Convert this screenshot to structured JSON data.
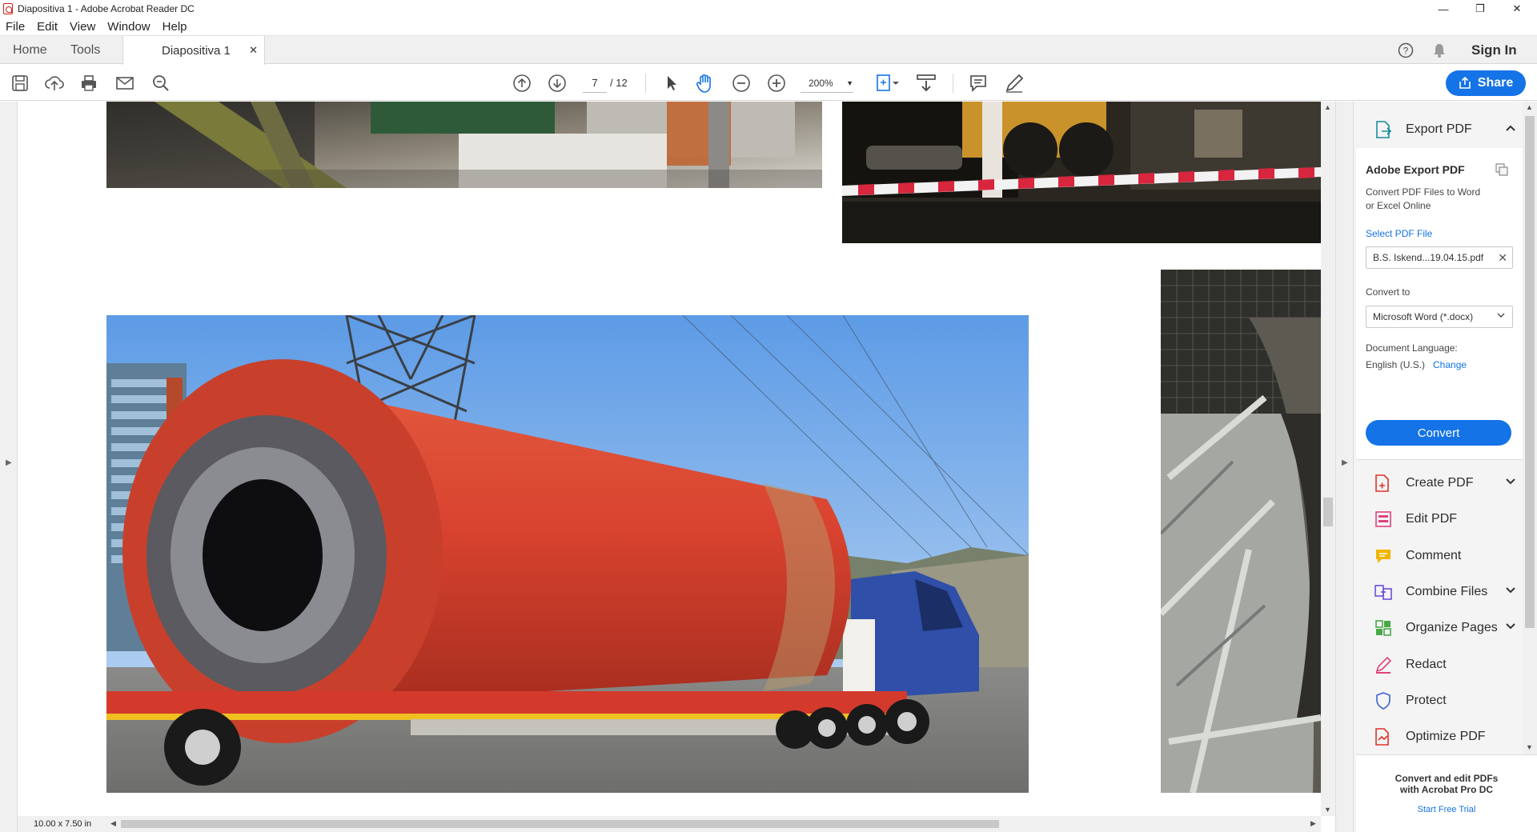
{
  "window": {
    "title": "Diapositiva 1 - Adobe Acrobat Reader DC"
  },
  "menu": {
    "file": "File",
    "edit": "Edit",
    "view": "View",
    "window": "Window",
    "help": "Help"
  },
  "tabs": {
    "home": "Home",
    "tools": "Tools",
    "document": "Diapositiva 1"
  },
  "header": {
    "sign_in": "Sign In"
  },
  "toolbar": {
    "current_page": "7",
    "page_total": "/ 12",
    "zoom": "200%",
    "share": "Share"
  },
  "statusbar": {
    "page_size": "10.00 x 7.50 in"
  },
  "export_panel": {
    "header": "Export PDF",
    "title": "Adobe Export PDF",
    "description_line1": "Convert PDF Files to Word",
    "description_line2": "or Excel Online",
    "select_label": "Select PDF File",
    "selected_file": "B.S. Iskend...19.04.15.pdf",
    "convert_to_label": "Convert to",
    "format": "Microsoft Word (*.docx)",
    "language_label": "Document Language:",
    "language_value": "English (U.S.)",
    "change_link": "Change",
    "convert_button": "Convert"
  },
  "tools": [
    {
      "label": "Create PDF",
      "icon": "create-pdf-icon",
      "color": "#e0312a",
      "expandable": true
    },
    {
      "label": "Edit PDF",
      "icon": "edit-pdf-icon",
      "color": "#e0427c",
      "expandable": false
    },
    {
      "label": "Comment",
      "icon": "comment-icon",
      "color": "#f0b400",
      "expandable": false
    },
    {
      "label": "Combine Files",
      "icon": "combine-files-icon",
      "color": "#6b4fd8",
      "expandable": true
    },
    {
      "label": "Organize Pages",
      "icon": "organize-pages-icon",
      "color": "#47a847",
      "expandable": true
    },
    {
      "label": "Redact",
      "icon": "redact-icon",
      "color": "#e0427c",
      "expandable": false
    },
    {
      "label": "Protect",
      "icon": "protect-icon",
      "color": "#3b63d4",
      "expandable": false
    },
    {
      "label": "Optimize PDF",
      "icon": "optimize-pdf-icon",
      "color": "#e0312a",
      "expandable": false
    }
  ],
  "promo": {
    "line1": "Convert and edit PDFs",
    "line2": "with Acrobat Pro DC",
    "trial_link": "Start Free Trial"
  },
  "colors": {
    "accent": "#1473e6",
    "drum_red": "#d9432f",
    "truck_blue": "#2f4fa8"
  }
}
